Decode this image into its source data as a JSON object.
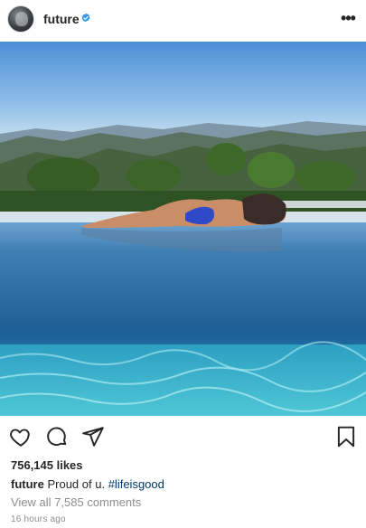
{
  "post": {
    "username": "future",
    "verified": true,
    "likes": "756,145 likes",
    "caption_user": "future",
    "caption_text": "Proud of u.",
    "caption_hashtag": "#lifeisgood",
    "comments_link": "View all 7,585 comments",
    "timestamp": "16 hours ago"
  },
  "icons": {
    "avatar": "profile-avatar",
    "verified": "verified-badge-icon",
    "more": "more-options-icon",
    "like": "heart-icon",
    "comment": "comment-bubble-icon",
    "share": "paper-plane-icon",
    "save": "bookmark-icon"
  },
  "colors": {
    "verified_blue": "#3897f0",
    "hashtag": "#00376b",
    "muted": "#8e8e8e",
    "text": "#262626"
  }
}
